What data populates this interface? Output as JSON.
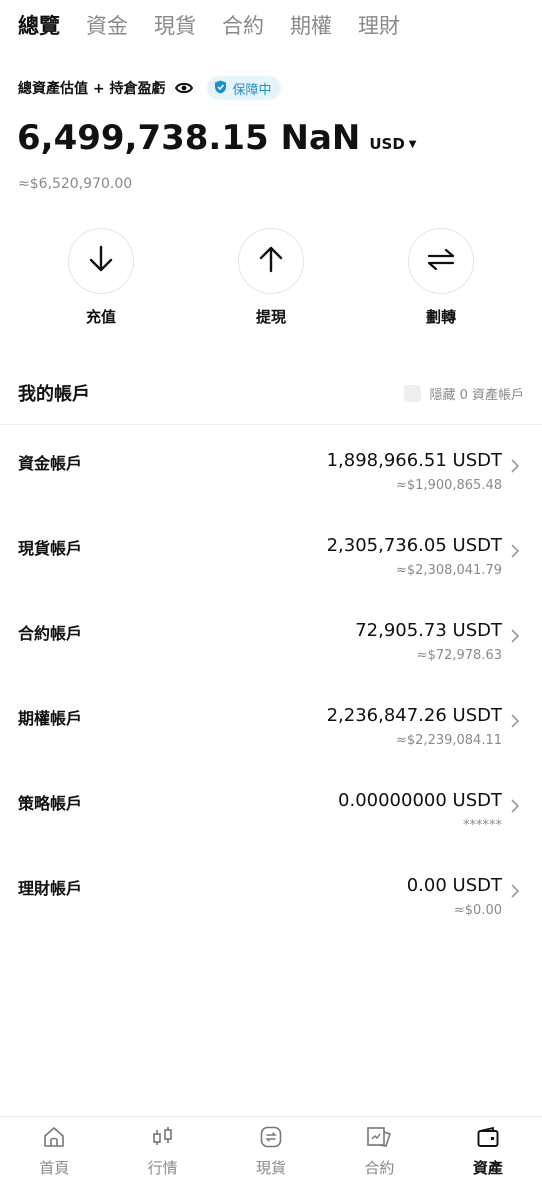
{
  "tabs": [
    {
      "label": "總覽",
      "active": true
    },
    {
      "label": "資金",
      "active": false
    },
    {
      "label": "現貨",
      "active": false
    },
    {
      "label": "合約",
      "active": false
    },
    {
      "label": "期權",
      "active": false
    },
    {
      "label": "理財",
      "active": false
    }
  ],
  "summary": {
    "label": "總資產估值 + 持倉盈虧",
    "badge": "保障中",
    "balance": "6,499,738.15 NaN",
    "currency": "USD",
    "approx": "≈$6,520,970.00"
  },
  "actions": [
    {
      "label": "充值",
      "icon": "arrow-down-icon"
    },
    {
      "label": "提現",
      "icon": "arrow-up-icon"
    },
    {
      "label": "劃轉",
      "icon": "transfer-icon"
    }
  ],
  "accounts_header": {
    "title": "我的帳戶",
    "hide_label": "隱藏 0 資產帳戶"
  },
  "accounts": [
    {
      "name": "資金帳戶",
      "amount": "1,898,966.51 USDT",
      "sub": "≈$1,900,865.48"
    },
    {
      "name": "現貨帳戶",
      "amount": "2,305,736.05 USDT",
      "sub": "≈$2,308,041.79"
    },
    {
      "name": "合約帳戶",
      "amount": "72,905.73 USDT",
      "sub": "≈$72,978.63"
    },
    {
      "name": "期權帳戶",
      "amount": "2,236,847.26 USDT",
      "sub": "≈$2,239,084.11"
    },
    {
      "name": "策略帳戶",
      "amount": "0.00000000 USDT",
      "sub": "******"
    },
    {
      "name": "理財帳戶",
      "amount": "0.00 USDT",
      "sub": "≈$0.00"
    }
  ],
  "bottom_nav": [
    {
      "label": "首頁",
      "icon": "home-icon",
      "active": false
    },
    {
      "label": "行情",
      "icon": "candlestick-icon",
      "active": false
    },
    {
      "label": "現貨",
      "icon": "spot-icon",
      "active": false
    },
    {
      "label": "合約",
      "icon": "futures-icon",
      "active": false
    },
    {
      "label": "資產",
      "icon": "wallet-icon",
      "active": true
    }
  ],
  "colors": {
    "accent": "#1c8fd0",
    "badge_bg": "#e8f4fb",
    "muted": "#8a8a8a"
  }
}
